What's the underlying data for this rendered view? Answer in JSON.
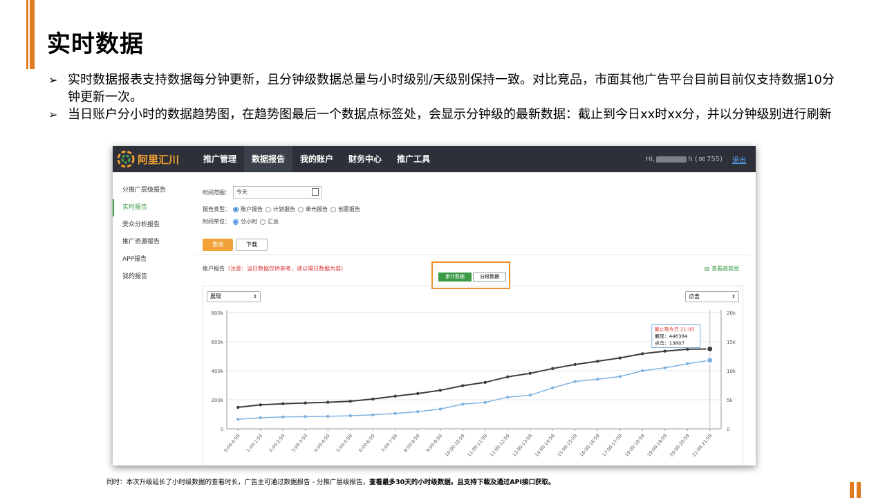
{
  "slide": {
    "title": "实时数据",
    "bullets": [
      "实时数据报表支持数据每分钟更新，且分钟级数据总量与小时级别/天级别保持一致。对比竞品，市面其他广告平台目前目前仅支持数据10分钟更新一次。",
      "当日账户分小时的数据趋势图，在趋势图最后一个数据点标签处，会显示分钟级的最新数据：截止到今日xx时xx分，并以分钟级别进行刷新"
    ],
    "footnote_plain": "同时：本次升级延长了小时级数据的查看时长，广告主可通过数据报告 - 分推广层级报告，",
    "footnote_bold": "查看最多30天的小时级数据。且支持下载及通过API接口获取。"
  },
  "app": {
    "brand": "阿里汇川",
    "nav": [
      "推广管理",
      "数据报告",
      "我的账户",
      "财务中心",
      "推广工具"
    ],
    "greeting_prefix": "Hi,",
    "greeting_suffix": "h (",
    "mail_count": "755)",
    "logout": "退出",
    "sidebar": [
      "分推广层级报告",
      "实时报告",
      "受众分析报告",
      "推广资源报告",
      "APP报告",
      "我的报告"
    ],
    "filters": {
      "time_range_label": "时间范围：",
      "time_range_value": "今天",
      "report_type_label": "报告类型：",
      "report_types": [
        "账户报告",
        "计划报告",
        "单元报告",
        "创意报告"
      ],
      "time_unit_label": "时间单位：",
      "time_units": [
        "分小时",
        "汇总"
      ],
      "query": "查询",
      "download": "下载"
    },
    "report_title": "账户报告",
    "report_note": "（注意：当日数据仅供参考，请以隔日数据为准）",
    "trend_link": "查看趋势图",
    "toggle": [
      "累计数据",
      "分段数据"
    ],
    "left_metric": "展现",
    "right_metric": "点击"
  },
  "chart_data": {
    "type": "line",
    "x": [
      "0:00-0:59",
      "1:00-1:59",
      "2:00-2:59",
      "3:00-3:59",
      "4:00-4:59",
      "5:00-5:59",
      "6:00-6:59",
      "7:00-7:59",
      "8:00-8:59",
      "9:00-9:59",
      "10:00-10:59",
      "11:00-11:59",
      "12:00-12:59",
      "13:00-13:59",
      "14:00-14:59",
      "15:00-15:59",
      "16:00-16:59",
      "17:00-17:59",
      "18:00-18:59",
      "19:00-19:59",
      "20:00-20:59",
      "21:00-21:59"
    ],
    "ylim_left": [
      0,
      800000
    ],
    "ylim_right": [
      0,
      20000
    ],
    "yticks_left": [
      "800k",
      "600k",
      "400k",
      "200k",
      "0"
    ],
    "yticks_right": [
      "20k",
      "15k",
      "10k",
      "5k",
      "0"
    ],
    "series": [
      {
        "name": "展现",
        "axis": "left",
        "color": "#3d3d3d",
        "values": [
          148000,
          165000,
          173000,
          178000,
          183000,
          190000,
          205000,
          225000,
          243000,
          265000,
          297000,
          320000,
          358000,
          382000,
          415000,
          443000,
          465000,
          488000,
          517000,
          535000,
          548000,
          550000
        ]
      },
      {
        "name": "点击",
        "axis": "right",
        "color": "#7fb2e0",
        "values": [
          1650,
          1900,
          2050,
          2100,
          2150,
          2250,
          2400,
          2650,
          2950,
          3400,
          4250,
          4550,
          5450,
          5800,
          7050,
          8150,
          8550,
          9000,
          10000,
          10500,
          11200,
          11800
        ]
      }
    ],
    "tooltip": {
      "title": "截止到今日 21:05",
      "line1": "展现：446384",
      "line2": "点击：13807"
    }
  }
}
